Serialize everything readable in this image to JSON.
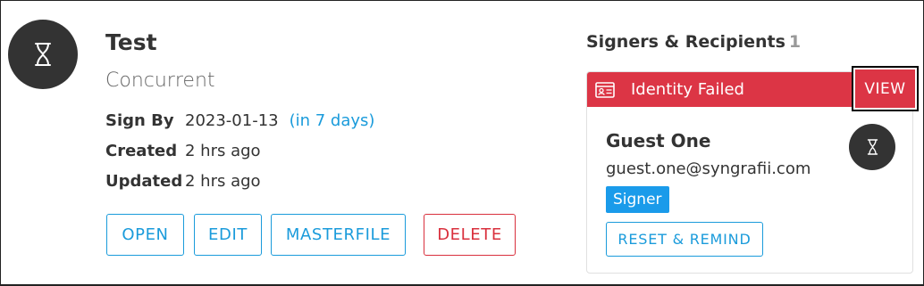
{
  "document": {
    "title": "Test",
    "subtitle": "Concurrent",
    "status_icon": "hourglass-icon",
    "meta": [
      {
        "label": "Sign By",
        "value": "2023-01-13",
        "relative": "(in 7 days)"
      },
      {
        "label": "Created",
        "value": "2 hrs ago"
      },
      {
        "label": "Updated",
        "value": "2 hrs ago"
      }
    ],
    "actions": {
      "open": "OPEN",
      "edit": "EDIT",
      "masterfile": "MASTERFILE",
      "delete": "DELETE"
    }
  },
  "signers": {
    "heading": "Signers & Recipients",
    "count": "1",
    "items": [
      {
        "status_text": "Identity Failed",
        "status_icon": "id-card-icon",
        "view_label": "VIEW",
        "name": "Guest One",
        "email": "guest.one@syngrafii.com",
        "role": "Signer",
        "reset_label": "RESET & REMIND",
        "avatar_icon": "hourglass-icon"
      }
    ]
  },
  "colors": {
    "primary": "#1a9bdb",
    "danger": "#dc3545",
    "avatar_bg": "#333333",
    "badge": "#1a9bea"
  }
}
